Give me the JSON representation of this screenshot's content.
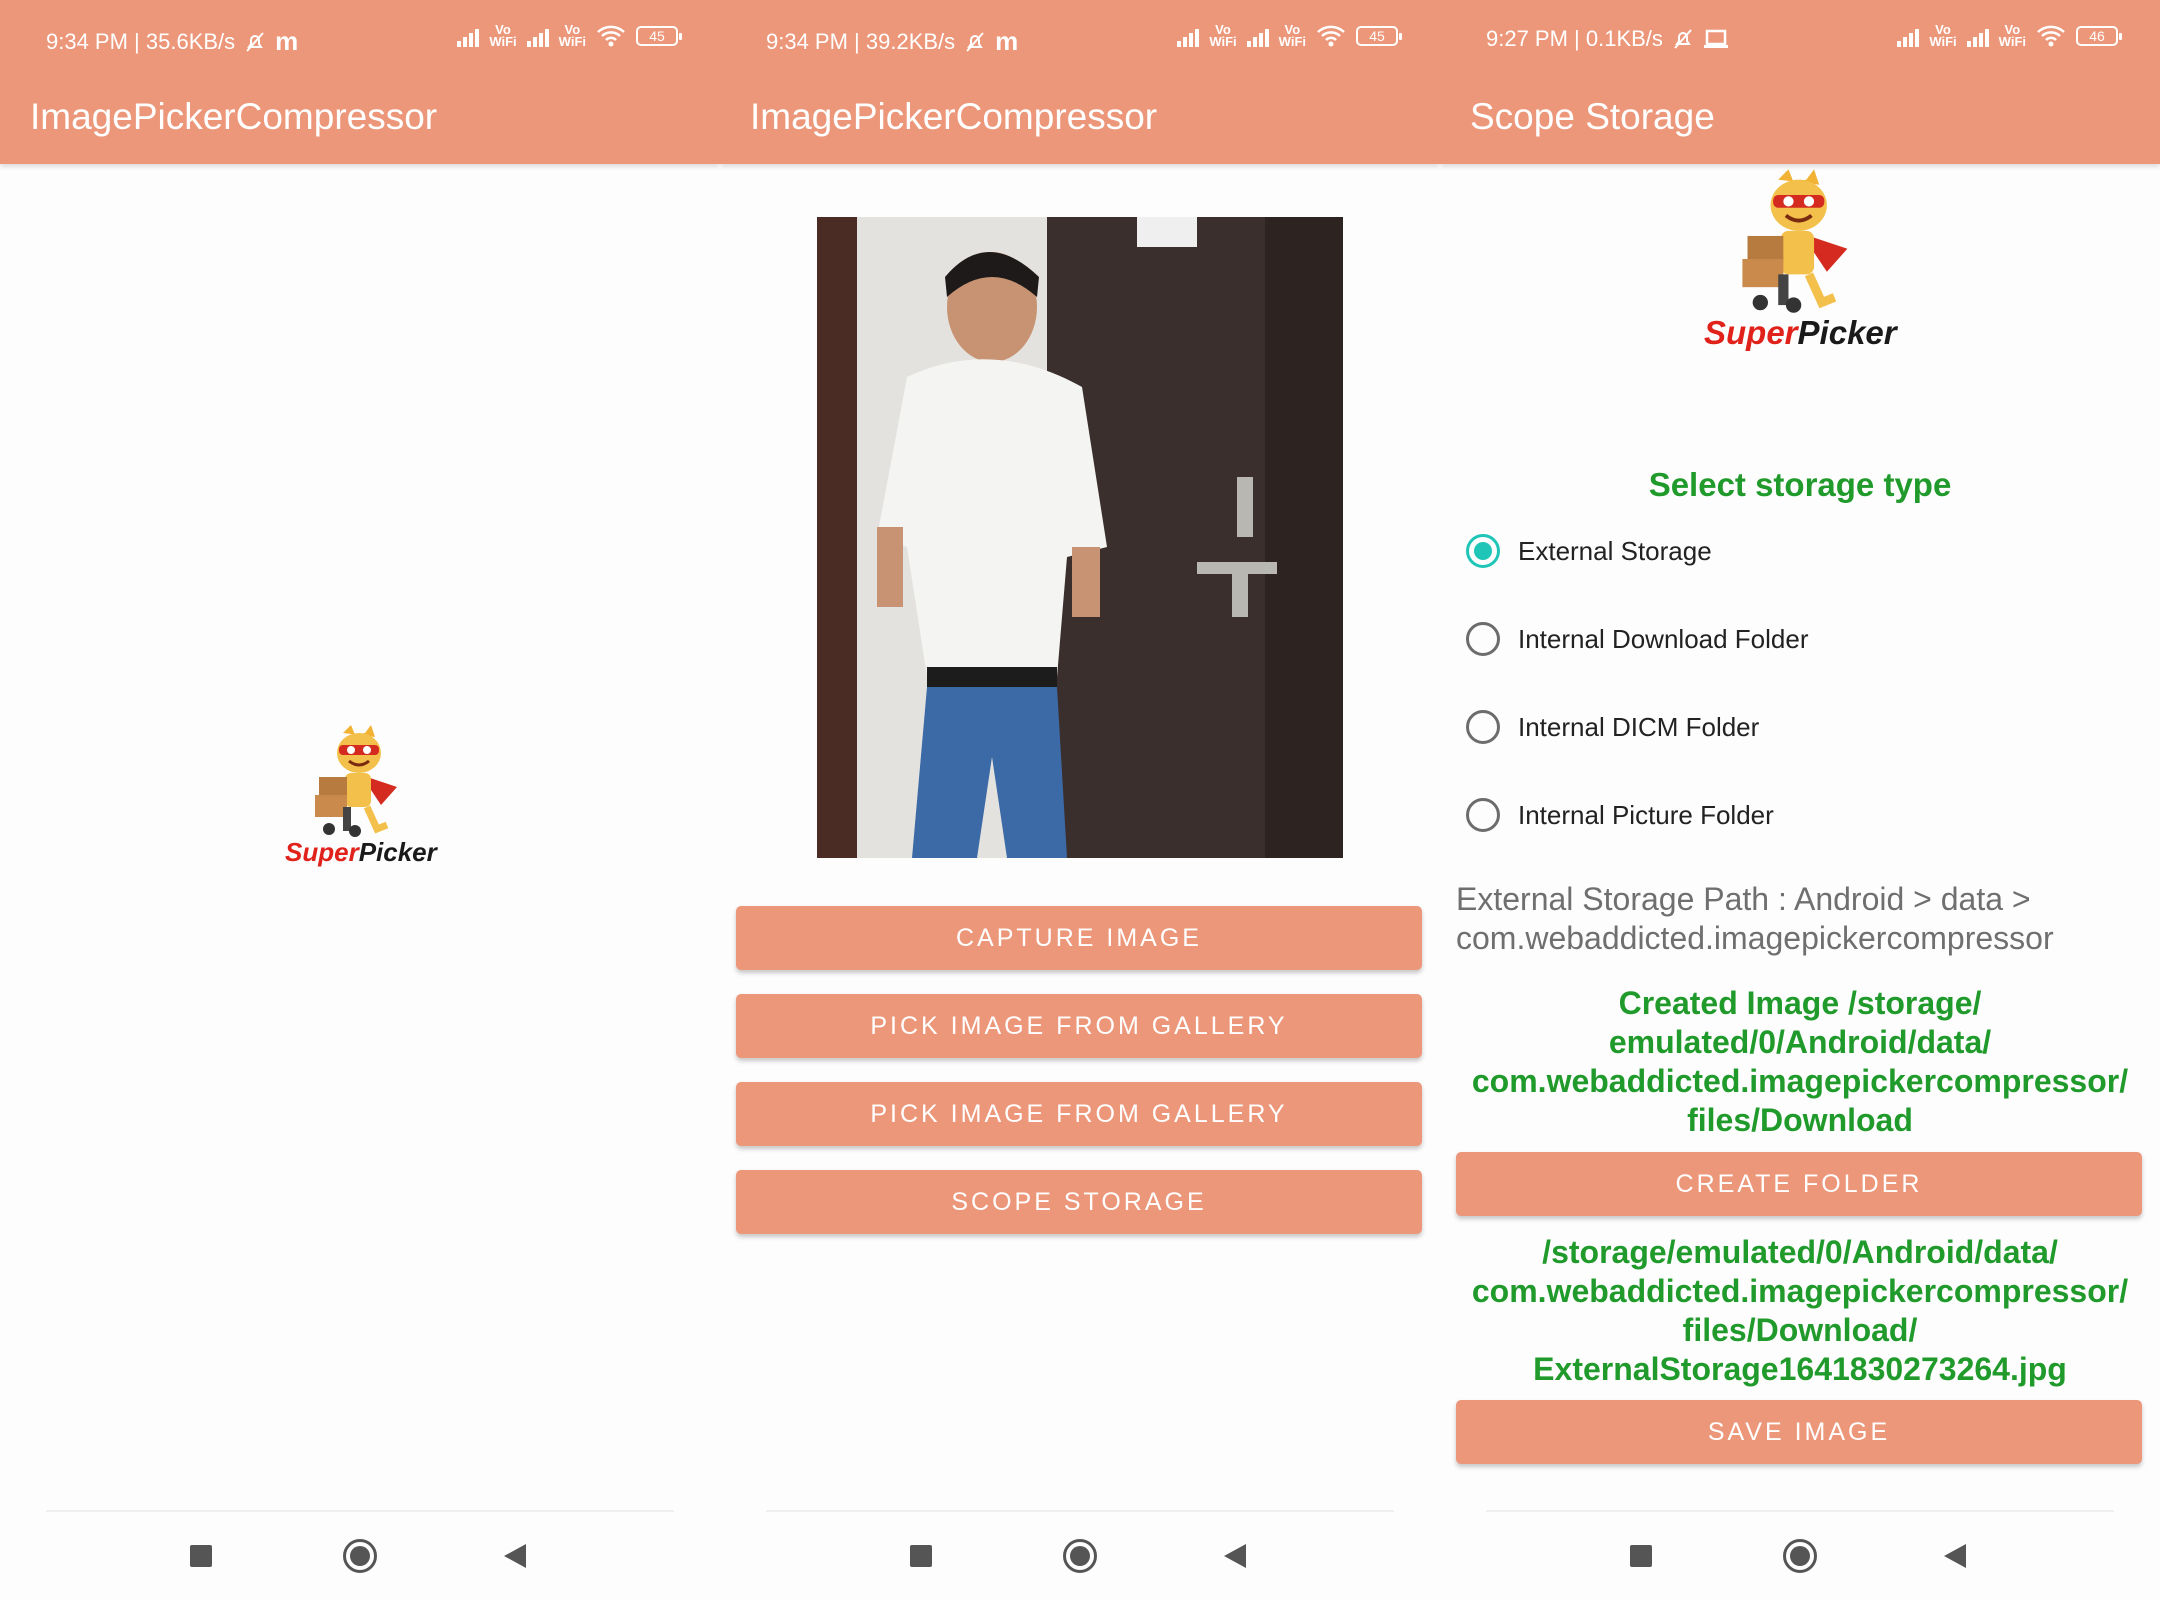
{
  "screens": [
    {
      "status": {
        "time_net": "9:34 PM | 35.6KB/s",
        "extra_icon": "m",
        "battery": "45",
        "vowifi": "Vo\nWiFi"
      },
      "title": "ImagePickerCompressor",
      "logo": {
        "super": "Super",
        "picker": "Picker"
      }
    },
    {
      "status": {
        "time_net": "9:34 PM | 39.2KB/s",
        "extra_icon": "m",
        "battery": "45",
        "vowifi": "Vo\nWiFi"
      },
      "title": "ImagePickerCompressor",
      "buttons": [
        "CAPTURE IMAGE",
        "PICK IMAGE FROM GALLERY",
        "PICK IMAGE FROM GALLERY",
        "SCOPE STORAGE"
      ]
    },
    {
      "status": {
        "time_net": "9:27 PM | 0.1KB/s",
        "battery": "46",
        "vowifi": "Vo\nWiFi"
      },
      "title": "Scope Storage",
      "logo": {
        "super": "Super",
        "picker": "Picker"
      },
      "select_title": "Select storage type",
      "radios": [
        {
          "label": "External Storage",
          "selected": true
        },
        {
          "label": "Internal Download Folder",
          "selected": false
        },
        {
          "label": "Internal DICM Folder",
          "selected": false
        },
        {
          "label": "Internal Picture Folder",
          "selected": false
        }
      ],
      "path_lines": [
        "External Storage Path : Android > data >",
        "com.webaddicted.imagepickercompressor"
      ],
      "created_lines": [
        "Created Image /storage/",
        "emulated/0/Android/data/",
        "com.webaddicted.imagepickercompressor/",
        "files/Download"
      ],
      "create_folder": "CREATE FOLDER",
      "file_lines": [
        "/storage/emulated/0/Android/data/",
        "com.webaddicted.imagepickercompressor/",
        "files/Download/",
        "ExternalStorage1641830273264.jpg"
      ],
      "save_image": "SAVE IMAGE"
    }
  ],
  "colors": {
    "accent": "#ec977a",
    "green_text": "#1f9a2b",
    "radio_on": "#1fc6b8"
  }
}
